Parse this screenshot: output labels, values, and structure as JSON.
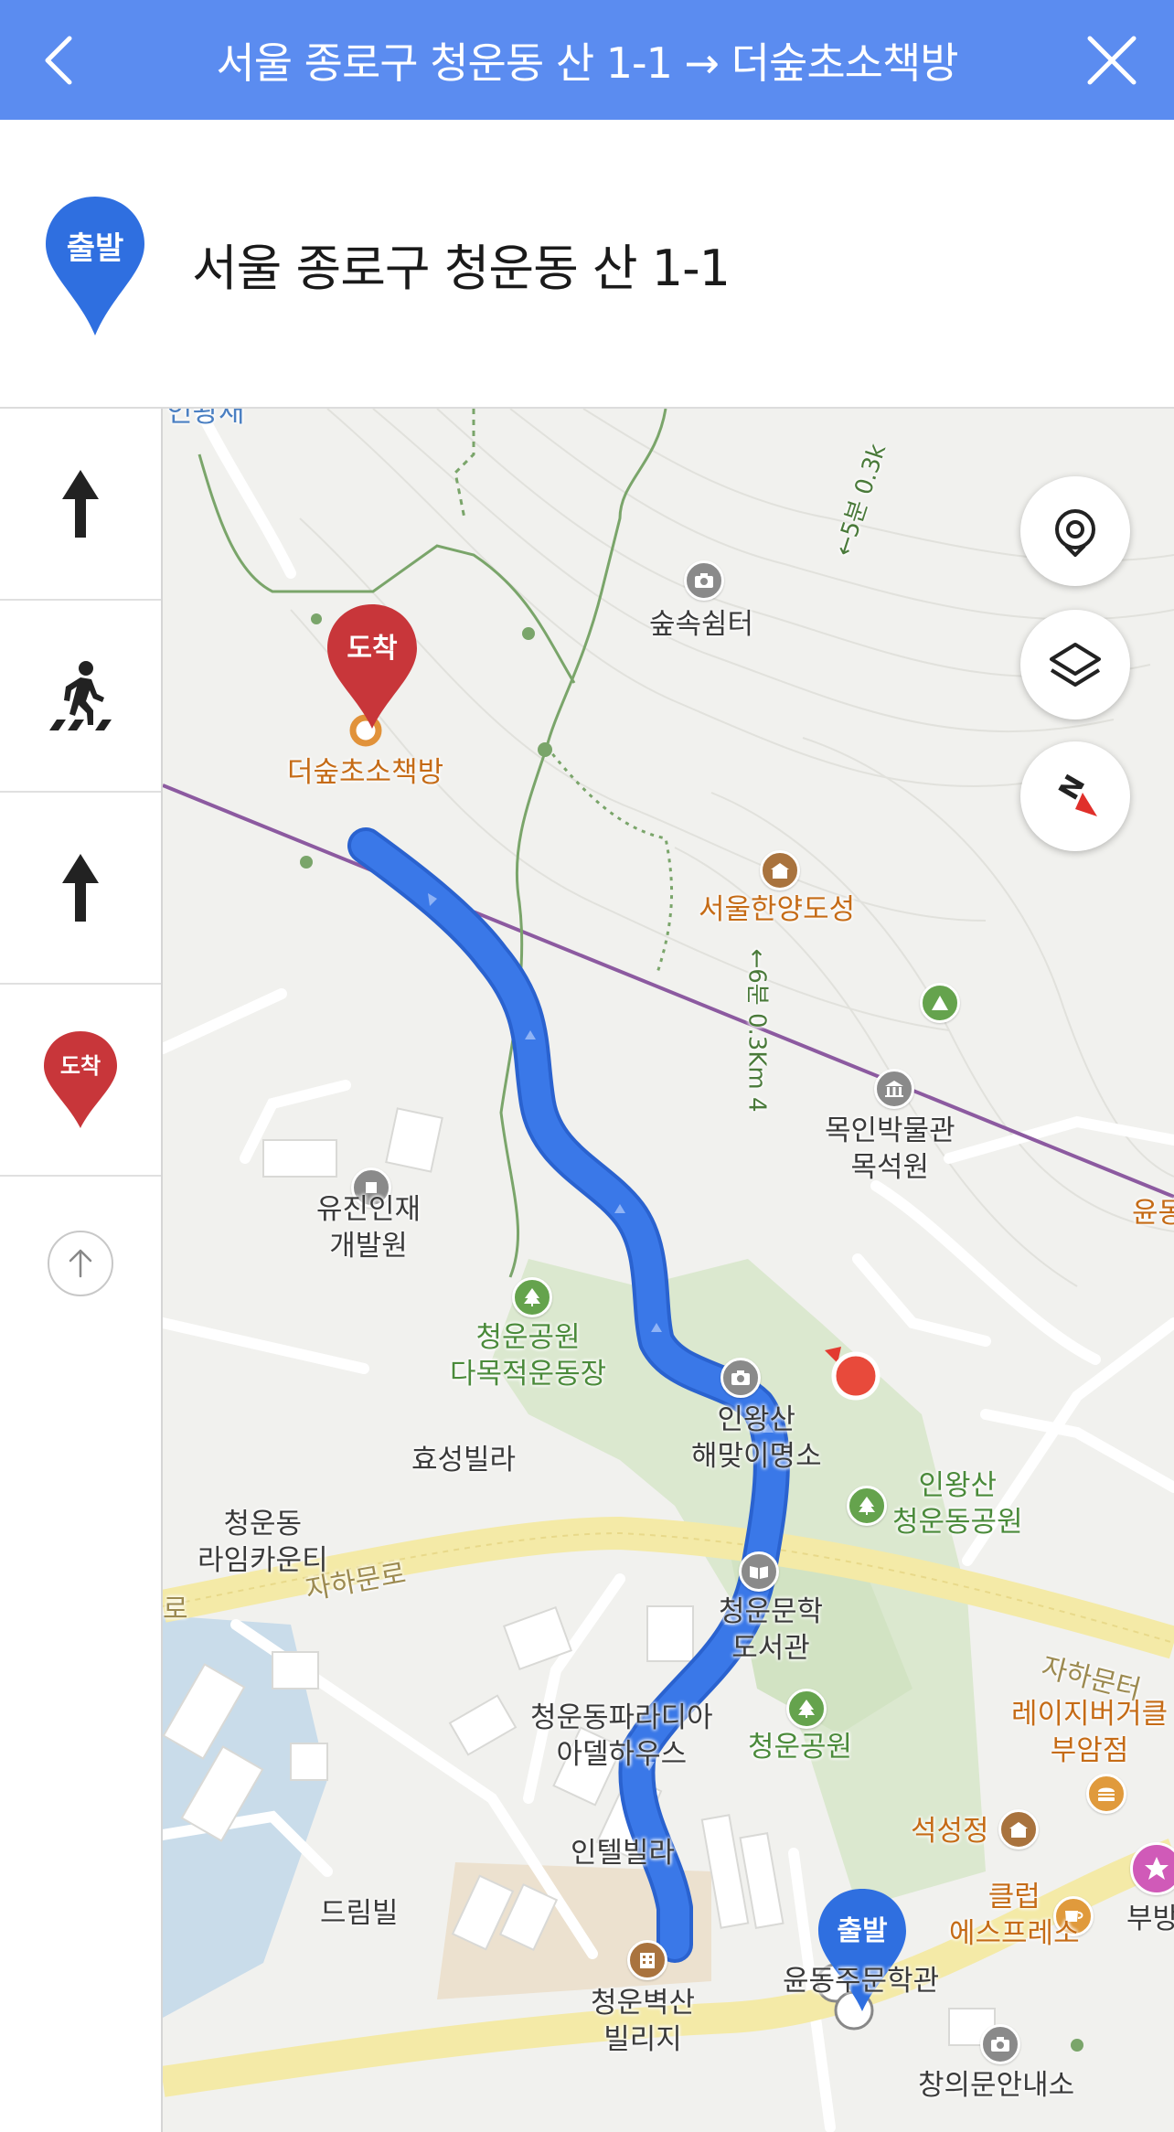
{
  "header": {
    "title": "서울 종로구 청운동 산 1-1 → 더숲초소책방",
    "back_icon": "chevron-left-icon",
    "close_icon": "close-icon",
    "background_color": "#5b8cf0"
  },
  "origin": {
    "pin_label": "출발",
    "address": "서울 종로구 청운동 산 1-1",
    "pin_color": "#2f6fe0"
  },
  "steps": [
    {
      "icon": "arrow-up-icon"
    },
    {
      "icon": "crosswalk-pedestrian-icon"
    },
    {
      "icon": "arrow-up-icon"
    },
    {
      "icon": "destination-pin-icon",
      "label": "도착"
    }
  ],
  "scroll_top_icon": "arrow-up-circle-icon",
  "map": {
    "route_color": "#3a78e8",
    "destination_pin_label": "도착",
    "start_pin_label": "출발",
    "controls": [
      "my-location-icon",
      "layers-icon",
      "compass-icon"
    ],
    "compass_letter": "N",
    "labels": {
      "destination": "더숲초소책방",
      "rest_area": "숲속쉼터",
      "fortress": "서울한양도성",
      "museum": "목인박물관\n목석원",
      "yujin": "유진인재\n개발원",
      "park_field": "청운공원\n다목적운동장",
      "sunrise_spot": "인왕산\n해맞이명소",
      "hyoseong": "효성빌라",
      "inwang_park": "인왕산\n청운동공원",
      "lime_county": "청운동\n라임카운티",
      "library": "청운문학\n도서관",
      "paradia": "청운동파라디아\n아델하우스",
      "cheongun_park": "청운공원",
      "burger": "레이지버거클\n부암점",
      "intel": "인텔빌라",
      "seokseong": "석성정",
      "dream": "드림빌",
      "club": "클럽\n에스프레소",
      "bubang": "부방",
      "byeoksan": "청운벽산\n빌리지",
      "literature_hall": "윤동주문학관",
      "changuimun": "창의문안내소",
      "road_left": "로",
      "road_jahamun": "자하문로",
      "road_jahamun_right": "자하문터",
      "trail_top": "←5분 0.3k",
      "trail_mid": "←6분 0.3Km 4",
      "yun": "윤동",
      "top_edge": "인왕재"
    }
  }
}
